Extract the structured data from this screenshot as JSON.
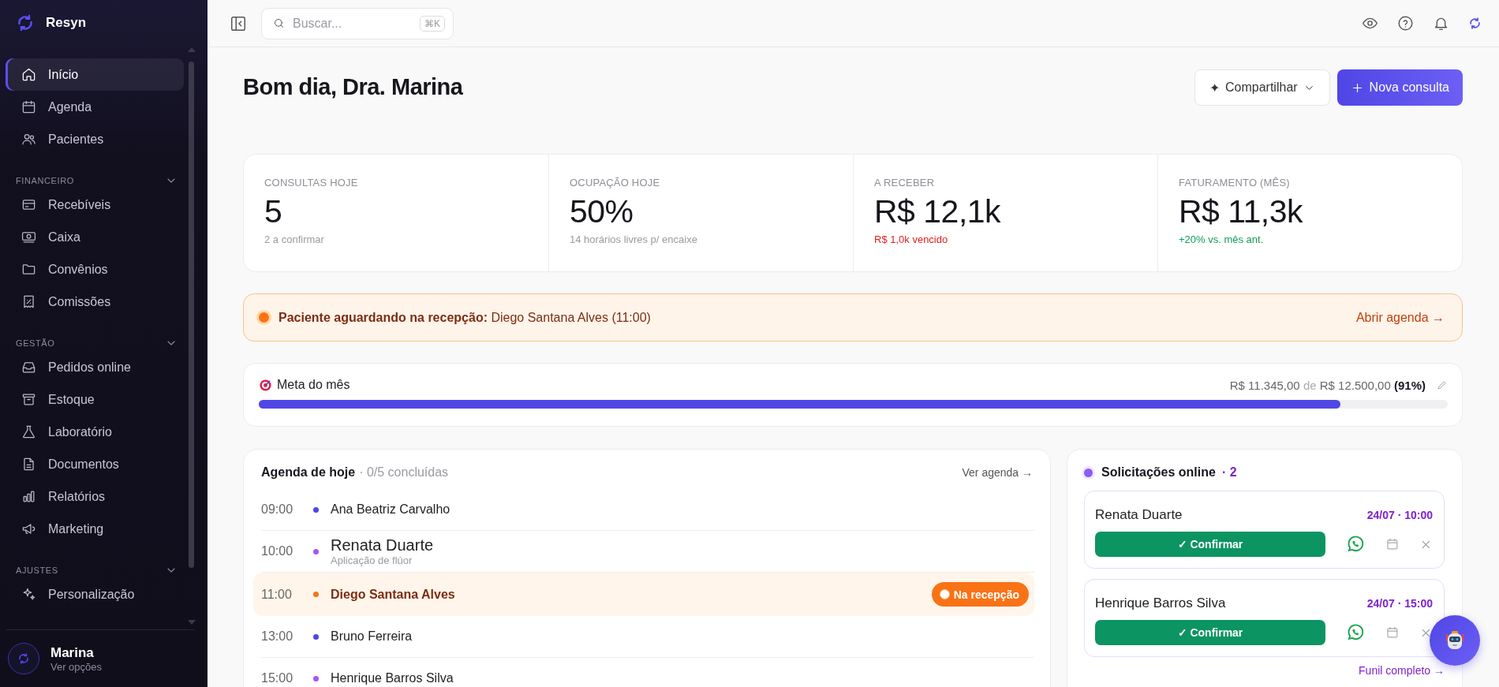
{
  "app": {
    "name": "Resyn"
  },
  "sidebar": {
    "items": [
      {
        "label": "Início",
        "selected": true
      },
      {
        "label": "Agenda",
        "selected": false
      },
      {
        "label": "Pacientes",
        "selected": false
      }
    ],
    "sections": [
      {
        "title": "FINANCEIRO",
        "expanded": true,
        "items": [
          {
            "label": "Recebíveis",
            "selected": false
          },
          {
            "label": "Caixa",
            "selected": false
          },
          {
            "label": "Convênios",
            "selected": false
          },
          {
            "label": "Comissões",
            "selected": false
          }
        ]
      },
      {
        "title": "GESTÃO",
        "expanded": true,
        "items": [
          {
            "label": "Pedidos online",
            "selected": false
          },
          {
            "label": "Estoque",
            "selected": false
          },
          {
            "label": "Laboratório",
            "selected": false
          },
          {
            "label": "Documentos",
            "selected": false
          },
          {
            "label": "Relatórios",
            "selected": false
          },
          {
            "label": "Marketing",
            "selected": false
          }
        ]
      },
      {
        "title": "AJUSTES",
        "expanded": true,
        "items": [
          {
            "label": "Personalização",
            "selected": false
          }
        ]
      }
    ]
  },
  "user": {
    "name": "Marina",
    "subtitle": "Ver opções"
  },
  "search": {
    "placeholder": "Buscar...",
    "shortcut": "⌘K"
  },
  "header": {
    "greeting": "Bom dia, Dra. Marina",
    "share_icon": "✦",
    "share_label": "Compartilhar",
    "new_label": "Nova consulta"
  },
  "stats": [
    {
      "label": "CONSULTAS HOJE",
      "value": "5",
      "note": "2 a confirmar",
      "color": "#9a9aa2"
    },
    {
      "label": "OCUPAÇÃO HOJE",
      "value": "50%",
      "note": "14 horários livres p/ encaixe",
      "color": "#9a9aa2"
    },
    {
      "label": "A RECEBER",
      "value": "R$ 12,1k",
      "note": "R$ 1,0k vencido",
      "color": "#e11d1d"
    },
    {
      "label": "FATURAMENTO (MÊS)",
      "value": "R$ 11,3k",
      "note": "+20% vs. mês ant.",
      "color": "#0f9d58"
    }
  ],
  "alert": {
    "text": "**Paciente aguardando na recepção:** Diego Santana Alves (11:00)",
    "link": "Abrir agenda →"
  },
  "goal": {
    "title": "Meta do mês",
    "current": "R$ 11.345,00",
    "separator": "de",
    "target": "R$ 12.500,00",
    "percent": "(91%)",
    "level": 0.91
  },
  "agenda": {
    "title": "Agenda de hoje",
    "summary": "· 0/5 concluídas",
    "link": "Ver agenda →",
    "rows": [
      {
        "time": "09:00",
        "name": "Ana Beatriz Carvalho",
        "color": "#4f46e5",
        "current": false
      },
      {
        "time": "10:00",
        "name": "Renata Duarte",
        "detail": "Aplicação de flúor",
        "color": "#a855f7",
        "current": false
      },
      {
        "time": "11:00",
        "name": "Diego Santana Alves",
        "color": "#f97316",
        "current": true,
        "badge": "Na recepção"
      },
      {
        "time": "13:00",
        "name": "Bruno Ferreira",
        "color": "#4f46e5",
        "current": false
      },
      {
        "time": "15:00",
        "name": "Henrique Barros Silva",
        "color": "#a855f7",
        "current": false
      }
    ]
  },
  "requests": {
    "title": "Solicitações online",
    "count": "· 2",
    "items": [
      {
        "name": "Renata Duarte",
        "when": "24/07 · 10:00",
        "action": "✓ Confirmar"
      },
      {
        "name": "Henrique Barros Silva",
        "when": "24/07 · 15:00",
        "action": "✓ Confirmar"
      }
    ],
    "link": "Funil completo →"
  }
}
